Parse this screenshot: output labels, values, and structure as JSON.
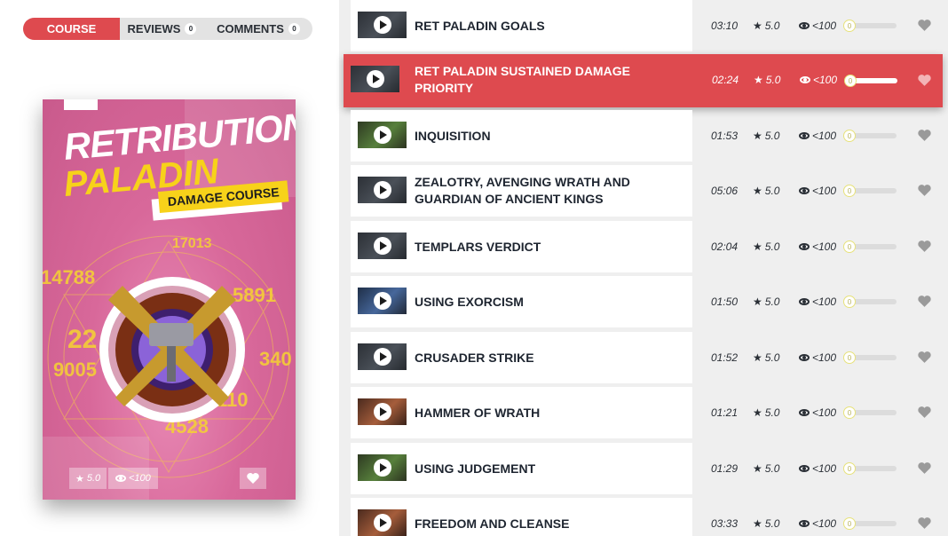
{
  "tabs": [
    {
      "label": "COURSE",
      "count": ""
    },
    {
      "label": "REVIEWS",
      "count": "0"
    },
    {
      "label": "COMMENTS",
      "count": "0"
    }
  ],
  "cover": {
    "title_line1": "RETRIBUTION",
    "title_line2": "PALADIN",
    "subtitle": "DAMAGE COURSE",
    "damage_numbers": [
      "17013",
      "14788",
      "5891",
      "22",
      "9005",
      "340",
      "110",
      "4528"
    ],
    "rating": "5.0",
    "views": "<100"
  },
  "lessons": [
    {
      "title": "RET PALADIN GOALS",
      "duration": "03:10",
      "rating": "5.0",
      "views": "<100",
      "progress": "0",
      "thumb": "dark"
    },
    {
      "title": "RET PALADIN SUSTAINED DAMAGE PRIORITY",
      "duration": "02:24",
      "rating": "5.0",
      "views": "<100",
      "progress": "0",
      "thumb": "dark",
      "active": true
    },
    {
      "title": "INQUISITION",
      "duration": "01:53",
      "rating": "5.0",
      "views": "<100",
      "progress": "0",
      "thumb": "green"
    },
    {
      "title": "ZEALOTRY, AVENGING WRATH AND GUARDIAN OF ANCIENT KINGS",
      "duration": "05:06",
      "rating": "5.0",
      "views": "<100",
      "progress": "0",
      "thumb": "dark"
    },
    {
      "title": "TEMPLARS VERDICT",
      "duration": "02:04",
      "rating": "5.0",
      "views": "<100",
      "progress": "0",
      "thumb": "dark"
    },
    {
      "title": "USING EXORCISM",
      "duration": "01:50",
      "rating": "5.0",
      "views": "<100",
      "progress": "0",
      "thumb": "blue"
    },
    {
      "title": "CRUSADER STRIKE",
      "duration": "01:52",
      "rating": "5.0",
      "views": "<100",
      "progress": "0",
      "thumb": "dark"
    },
    {
      "title": "HAMMER OF WRATH",
      "duration": "01:21",
      "rating": "5.0",
      "views": "<100",
      "progress": "0",
      "thumb": "orange"
    },
    {
      "title": "USING JUDGEMENT",
      "duration": "01:29",
      "rating": "5.0",
      "views": "<100",
      "progress": "0",
      "thumb": "green"
    },
    {
      "title": "FREEDOM AND CLEANSE",
      "duration": "03:33",
      "rating": "5.0",
      "views": "<100",
      "progress": "0",
      "thumb": "orange"
    }
  ],
  "colors": {
    "accent": "#de4a4f",
    "cover_yellow": "#f7d21a",
    "cover_pink": "#d8689a",
    "list_bg": "#efefef"
  },
  "icons": [
    "play-icon",
    "star-icon",
    "eye-icon",
    "heart-icon"
  ]
}
